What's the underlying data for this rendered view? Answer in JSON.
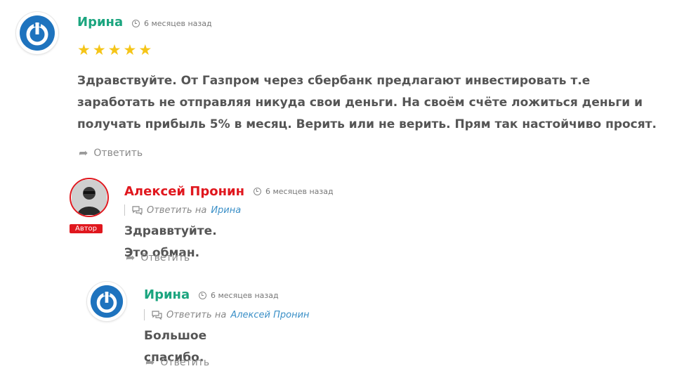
{
  "comments": [
    {
      "author": "Ирина",
      "author_color": "#1ba57f",
      "time": "6 месяцев назад",
      "rating": 5,
      "rating_stars": "★★★★★",
      "text": "Здравствуйте. От Газпром через сбербанк предлагают инвестировать т.е заработать не отправляя никуда свои деньги. На своём счёте ложиться деньги и получать прибыль 5% в месяц. Верить или не верить. Прям так настойчиво просят.",
      "reply_label": "Ответить",
      "avatar_icon": "gravatar-power-icon"
    },
    {
      "author": "Алексей Пронин",
      "author_color": "#e0171e",
      "time": "6 месяцев назад",
      "badge": "Автор",
      "reply_prefix": "Ответить на",
      "reply_target": "Ирина",
      "text": "Здраввтуйте. Это обман.",
      "reply_label": "Ответить",
      "avatar_icon": "user-photo"
    },
    {
      "author": "Ирина",
      "author_color": "#1ba57f",
      "time": "6 месяцев назад",
      "reply_prefix": "Ответить на",
      "reply_target": "Алексей Пронин",
      "text": "Большое спасибо.",
      "reply_label": "Ответить",
      "avatar_icon": "gravatar-power-icon"
    }
  ]
}
